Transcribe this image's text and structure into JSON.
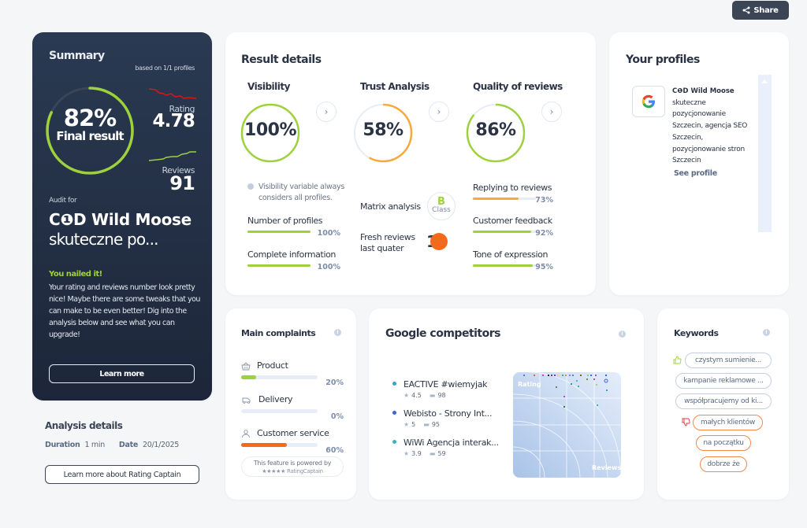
{
  "header": {
    "share_label": "Share"
  },
  "summary": {
    "title": "Summary",
    "based_on": "based on 1/1 profiles",
    "final_percent": "82%",
    "final_value": 82,
    "final_label": "Final result",
    "rating_label": "Rating",
    "rating_value": "4.78",
    "reviews_label": "Reviews",
    "reviews_value": "91",
    "audit_for_label": "Audit for",
    "business_name_line1": "C❶D Wild Moose",
    "business_name_line2": "skuteczne po...",
    "nailed_title": "You nailed it!",
    "nailed_text": "Your rating and reviews number look pretty nice! Maybe there are some tweaks that you can make to be even better! Dig into the analysis below and see what you can upgrade!",
    "learn_more_label": "Learn more",
    "colors": {
      "ring": "#9ed13b",
      "rating_trend": "#d11a1a",
      "reviews_trend": "#9ed13b"
    }
  },
  "analysis_details": {
    "title": "Analysis details",
    "duration_label": "Duration",
    "duration_value": "1 min",
    "date_label": "Date",
    "date_value": "20/1/2025",
    "button_label": "Learn more about Rating Captain"
  },
  "result_details": {
    "title": "Result details",
    "metrics": [
      {
        "title": "Visibility",
        "percent_text": "100%",
        "value": 100,
        "color": "#9ed13b"
      },
      {
        "title": "Trust Analysis",
        "percent_text": "58%",
        "value": 58,
        "color": "#f7a93b"
      },
      {
        "title": "Quality of reviews",
        "percent_text": "86%",
        "value": 86,
        "color": "#9ed13b"
      }
    ],
    "visibility_note": "Visibility variable always considers all profiles.",
    "visibility_sub": [
      {
        "label": "Number of profiles",
        "percent_text": "100%",
        "value": 100,
        "color": "#9ed13b"
      },
      {
        "label": "Complete information",
        "percent_text": "100%",
        "value": 100,
        "color": "#9ed13b"
      }
    ],
    "matrix_label": "Matrix analysis",
    "matrix_class_letter": "B",
    "matrix_class_label": "Class",
    "fresh_label_line1": "Fresh reviews",
    "fresh_label_line2": "last quater",
    "fresh_value": "1",
    "quality_sub": [
      {
        "label": "Replying to reviews",
        "percent_text": "73%",
        "value": 73,
        "color": "#f7a93b"
      },
      {
        "label": "Customer feedback",
        "percent_text": "92%",
        "value": 92,
        "color": "#9ed13b"
      },
      {
        "label": "Tone of expression",
        "percent_text": "95%",
        "value": 95,
        "color": "#9ed13b"
      }
    ]
  },
  "profiles": {
    "title": "Your profiles",
    "items": [
      {
        "platform_icon": "google-icon",
        "name_bold": "C❶D Wild Moose",
        "name_rest": "skuteczne pozycjonowanie Szczecin, agencja SEO Szczecin, pozycjonowanie stron Szczecin",
        "see_profile_label": "See profile"
      }
    ]
  },
  "complaints": {
    "title": "Main complaints",
    "items": [
      {
        "icon": "basket-icon",
        "label": "Product",
        "percent_text": "20%",
        "value": 20,
        "color": "#9ed13b"
      },
      {
        "icon": "van-icon",
        "label": "Delivery",
        "percent_text": "0%",
        "value": 0,
        "color": "#9ed13b"
      },
      {
        "icon": "person-icon",
        "label": "Customer service",
        "percent_text": "60%",
        "value": 60,
        "color": "#f26b1d"
      }
    ],
    "powered_line1": "This feature is powered by",
    "powered_line2": "★★★★★ RatingCaptain"
  },
  "competitors": {
    "title": "Google competitors",
    "items": [
      {
        "name": "EACTIVE #wiemyjak",
        "rating": "4.5",
        "reviews": "98",
        "color": "#3aa0c8"
      },
      {
        "name": "Webisto - Strony Int...",
        "rating": "5",
        "reviews": "95",
        "color": "#3a63e0"
      },
      {
        "name": "WiWi Agencja interak...",
        "rating": "3.9",
        "reviews": "59",
        "color": "#3ab4b4"
      }
    ],
    "chart_y_label": "Rating",
    "chart_x_label": "Reviews"
  },
  "keywords": {
    "title": "Keywords",
    "positive": [
      "czystym sumienie...",
      "kampanie reklamowe ...",
      "współpracujemy od ki..."
    ],
    "negative": [
      "małych klientów",
      "na początku",
      "dobrze że"
    ]
  }
}
